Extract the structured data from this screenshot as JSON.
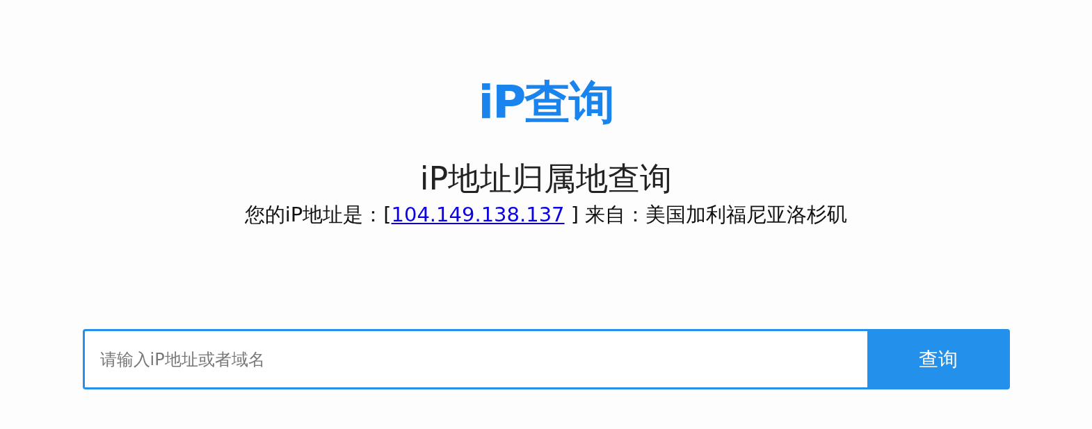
{
  "logo": "iP查询",
  "heading": "iP地址归属地查询",
  "info": {
    "prefix": "您的iP地址是：[",
    "ip": "104.149.138.137",
    "suffix": " ] 来自：美国加利福尼亚洛杉矶"
  },
  "search": {
    "placeholder": "请输入iP地址或者域名",
    "button": "查询"
  }
}
